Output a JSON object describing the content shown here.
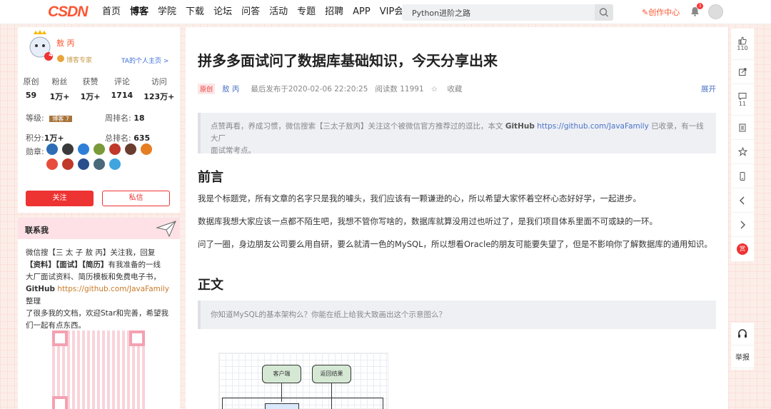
{
  "topnav": {
    "logo": "CSDN",
    "items": [
      "首页",
      "博客",
      "学院",
      "下载",
      "论坛",
      "问答",
      "活动",
      "专题",
      "招聘",
      "APP",
      "VIP会员"
    ],
    "active_index": 1,
    "search_value": "Python进阶之路",
    "creator_label": "创作中心",
    "bell_count": "3"
  },
  "profile": {
    "name": "敖 丙",
    "level_badge": "4",
    "level_title": "博客专家",
    "homepage_link": "TA的个人主页 >",
    "stats": [
      {
        "label": "原创",
        "value": "59"
      },
      {
        "label": "粉丝",
        "value": "1万+"
      },
      {
        "label": "获赞",
        "value": "1万+"
      },
      {
        "label": "评论",
        "value": "1714"
      },
      {
        "label": "访问",
        "value": "123万+"
      }
    ],
    "grade_label": "等级:",
    "grade_badge": "博客 7",
    "week_rank_label": "周排名:",
    "week_rank": "18",
    "points_label": "积分:",
    "points": "1万+",
    "total_rank_label": "总排名:",
    "total_rank": "635",
    "medals_label": "勋章:",
    "medal_colors": [
      "#2d6db5",
      "#3a3a3a",
      "#2f7fd8",
      "#7a9a3a",
      "#c0392b",
      "#6b3d2e",
      "#e67e22",
      "#e74c3c",
      "#c0392b",
      "#2b4f8c",
      "#4a6a7a",
      "#3fa4e0"
    ],
    "follow_label": "关注",
    "message_label": "私信"
  },
  "contact": {
    "title": "联系我",
    "lines": [
      {
        "t": "微信搜【三 太 子 敖 丙】关注我，回复",
        "b": false
      },
      {
        "t": "【资料】【面试】【简历】",
        "b": true,
        "rest": "有我准备的一线"
      },
      {
        "t": "大厂面试资料、简历模板和免费电子书，",
        "b": false
      },
      {
        "t": "GitHub",
        "b": true,
        "link": "https://github.com/JavaFamily",
        "rest": " 整理"
      },
      {
        "t": "了很多我的文档，欢迎Star和完善，希望我",
        "b": false
      },
      {
        "t": "们一起有点东西。",
        "b": false
      }
    ]
  },
  "article": {
    "title": "拼多多面试问了数据库基础知识，今天分享出来",
    "original_tag": "原创",
    "author": "敖 丙",
    "published": "最后发布于2020-02-06 22:20:25",
    "read_count": "阅读数 11991",
    "favorite_label": "收藏",
    "expand_label": "展开",
    "quote1_pre": "点赞再看，养成习惯，微信搜索【三太子敖丙】关注这个被微信官方推荐过的逗比，本文 ",
    "quote1_bold": "GitHub",
    "quote1_url": "https://github.com/JavaFamily",
    "quote1_post": " 已收录，有一线大厂",
    "quote1_line2": "面试常考点。",
    "h_preface": "前言",
    "p1": "我是个标题党，所有文章的名字只是我的噱头，我们应该有一颗谦逊的心，所以希望大家怀着空杯心态好好学，一起进步。",
    "p2": "数据库我想大家应该一点都不陌生吧，我想不管你写啥的，数据库就算没用过也听过了，是我们项目体系里面不可或缺的一环。",
    "p3": "问了一圈，身边朋友公司要么用自研，要么就清一色的MySQL，所以想看Oracle的朋友可能要失望了，但是不影响你了解数据库的通用知识。",
    "h_body": "正文",
    "quote2": "你知道MySQL的基本架构么？你能在纸上给我大致画出这个示意图么？",
    "diagram_nodes": [
      "客户端",
      "返回结果"
    ]
  },
  "toolbar": {
    "like_count": "110",
    "comment_count": "11",
    "reward_label": "赏",
    "report_label": "举报"
  }
}
